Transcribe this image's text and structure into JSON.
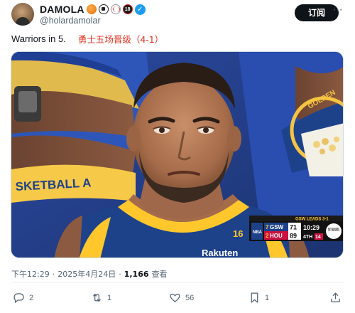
{
  "author": {
    "display_name": "DAMOLA",
    "handle": "@holardamolar",
    "badges": [
      "basketball-emoji",
      "soccer-ball-emoji",
      "baseball-emoji",
      "no-under-18-emoji"
    ],
    "badge_18_text": "18",
    "verified_check": "✓",
    "avatar_icon": "profile-avatar"
  },
  "subscribe_label": "订阅",
  "tweet": {
    "text_en": "Warriors in 5.",
    "text_zh": "勇士五场晋级（4-1）"
  },
  "media": {
    "jersey_team_text": "GOLDEN STATE WARRIORS",
    "court_text": "SKETBALL A",
    "jersey_number": "16",
    "jersey_sponsor": "Rakuten",
    "scoreboard": {
      "series_text": "GSW LEADS 3-1",
      "network_text": "TNT SPORTS",
      "league_text": "NBA",
      "away_team": "GSW",
      "away_score": "71",
      "away_seed": "7",
      "home_team": "HOU",
      "home_score": "89",
      "home_seed": "2",
      "clock": "10:29",
      "period": "4TH",
      "shot_clock": "14"
    }
  },
  "meta": {
    "time": "下午12:29",
    "separator": "·",
    "date": "2025年4月24日",
    "views_count": "1,166",
    "views_label": "查看"
  },
  "actions": {
    "replies": "2",
    "reposts": "1",
    "likes": "56",
    "bookmarks": "1"
  },
  "colors": {
    "accent": "#1d9bf0",
    "warriors_blue": "#1d428a",
    "warriors_gold": "#ffc72c",
    "chinese_text": "#e0301e"
  }
}
